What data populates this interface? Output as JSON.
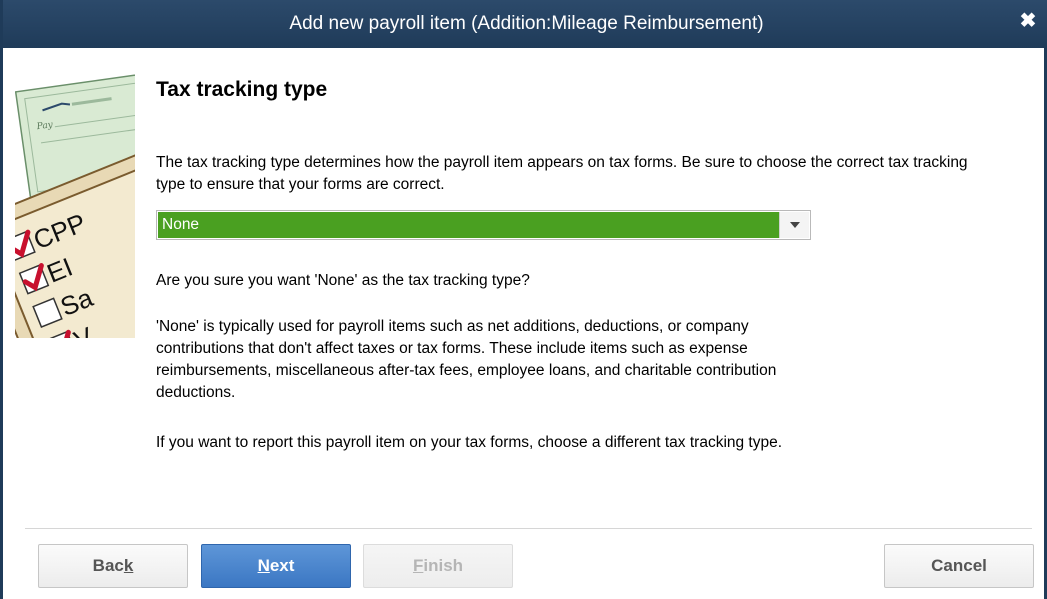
{
  "window": {
    "title": "Add new payroll item (Addition:Mileage Reimbursement)",
    "close_glyph": "✖"
  },
  "illustration": {
    "labels": [
      "CPP",
      "EI",
      "Sa",
      "V"
    ],
    "pay_label": "Pay"
  },
  "main": {
    "heading": "Tax tracking type",
    "description": "The tax tracking type determines how the payroll item appears on tax forms.  Be sure to choose the correct tax tracking type to ensure that your forms are correct.",
    "tax_tracking_select": {
      "selected": "None",
      "icon": "chevron-down-icon"
    },
    "confirm_question": "Are you sure you want 'None' as the tax tracking type?",
    "info_paragraph": "'None' is typically used for payroll items such as net additions, deductions, or company contributions that don't affect taxes or tax forms.  These include items such as expense reimbursements, miscellaneous after-tax fees, employee loans, and charitable contribution deductions.",
    "advice_paragraph": "If you want to report this payroll item on your tax forms, choose a different tax tracking type."
  },
  "footer": {
    "back": {
      "pre": "Bac",
      "u": "k",
      "post": ""
    },
    "next": {
      "pre": "",
      "u": "N",
      "post": "ext"
    },
    "finish": {
      "pre": "",
      "u": "F",
      "post": "inish"
    },
    "cancel": {
      "label": "Cancel"
    }
  },
  "colors": {
    "titlebar": "#1f3b59",
    "selection": "#4aa021",
    "primary_button": "#3b77c3",
    "check_red": "#c8102e"
  }
}
